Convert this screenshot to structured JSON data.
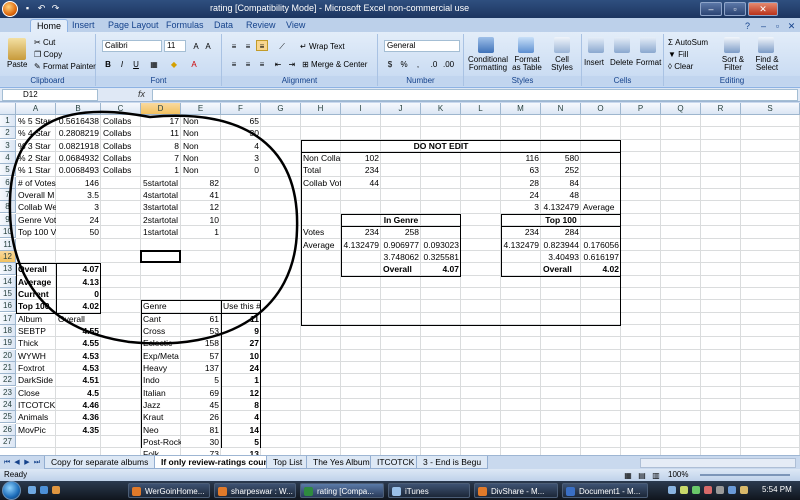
{
  "window": {
    "title": "rating  [Compatibility Mode] - Microsoft Excel non-commercial use",
    "minimize": "–",
    "maximize": "▫",
    "close": "✕"
  },
  "ribbon_tabs": [
    "Home",
    "Insert",
    "Page Layout",
    "Formulas",
    "Data",
    "Review",
    "View"
  ],
  "ribbon": {
    "clipboard": {
      "paste": "Paste",
      "cut": "Cut",
      "copy": "Copy",
      "format_painter": "Format Painter",
      "label": "Clipboard"
    },
    "font": {
      "name": "Calibri",
      "size": "11",
      "label": "Font",
      "bold": "B",
      "italic": "I",
      "underline": "U"
    },
    "alignment": {
      "wrap": "Wrap Text",
      "merge": "Merge & Center",
      "label": "Alignment"
    },
    "number": {
      "format": "General",
      "label": "Number",
      "dollar": "$",
      "percent": "%",
      "comma": ","
    },
    "styles": {
      "conditional": "Conditional Formatting",
      "format_table": "Format as Table",
      "cell_styles": "Cell Styles",
      "label": "Styles"
    },
    "cells": {
      "insert": "Insert",
      "delete": "Delete",
      "format": "Format",
      "label": "Cells"
    },
    "editing": {
      "autosum": "AutoSum",
      "fill": "Fill",
      "clear": "Clear",
      "sort": "Sort & Filter",
      "find": "Find & Select",
      "label": "Editing"
    }
  },
  "formula_bar": {
    "name_box": "D12",
    "fx": "fx",
    "value": ""
  },
  "columns": [
    "A",
    "B",
    "C",
    "D",
    "E",
    "F",
    "G",
    "H",
    "I",
    "J",
    "K",
    "L",
    "M",
    "N",
    "O",
    "P",
    "Q",
    "R",
    "S"
  ],
  "rows": [
    "1",
    "2",
    "3",
    "4",
    "5",
    "6",
    "7",
    "8",
    "9",
    "10",
    "11",
    "12",
    "13",
    "14",
    "15",
    "16",
    "17",
    "18",
    "19",
    "20",
    "21",
    "22",
    "23",
    "24",
    "25",
    "26",
    "27"
  ],
  "cells": {
    "left_block": [
      [
        "% 5 Star",
        "0.5616438",
        "Collabs",
        "17",
        "Non",
        "65"
      ],
      [
        "% 4 Star",
        "0.2808219",
        "Collabs",
        "11",
        "Non",
        "30"
      ],
      [
        "% 3 Star",
        "0.0821918",
        "Collabs",
        "8",
        "Non",
        "4"
      ],
      [
        "% 2 Star",
        "0.0684932",
        "Collabs",
        "7",
        "Non",
        "3"
      ],
      [
        "% 1 Star",
        "0.0068493",
        "Collabs",
        "1",
        "Non",
        "0"
      ],
      [
        "# of Votes",
        "146",
        "",
        "5startotal",
        "82",
        ""
      ],
      [
        "Overall M",
        "3.5",
        "",
        "4startotal",
        "41",
        ""
      ],
      [
        "Collab We",
        "3",
        "",
        "3startotal",
        "12",
        ""
      ],
      [
        "Genre Vot",
        "24",
        "",
        "2startotal",
        "10",
        ""
      ],
      [
        "Top 100 V",
        "50",
        "",
        "1startotal",
        "1",
        ""
      ]
    ],
    "summary": [
      [
        "Overall",
        "4.07"
      ],
      [
        "Average",
        "4.13"
      ],
      [
        "Current",
        "0"
      ],
      [
        "Top 100",
        "4.02"
      ]
    ],
    "album_header": [
      "Album",
      "Overall"
    ],
    "albums": [
      [
        "SEBTP",
        "4.55"
      ],
      [
        "Thick",
        "4.55"
      ],
      [
        "WYWH",
        "4.53"
      ],
      [
        "Foxtrot",
        "4.53"
      ],
      [
        "DarkSide",
        "4.51"
      ],
      [
        "Close",
        "4.5"
      ],
      [
        "ITCOTCK",
        "4.46"
      ],
      [
        "Animals",
        "4.36"
      ],
      [
        "MovPic",
        "4.35"
      ]
    ],
    "genre_header": [
      "Genre",
      "",
      "Use this #"
    ],
    "genres": [
      [
        "Cant",
        "61",
        "11"
      ],
      [
        "Cross",
        "53",
        "9"
      ],
      [
        "Eclectic",
        "158",
        "27"
      ],
      [
        "Exp/Meta",
        "57",
        "10"
      ],
      [
        "Heavy",
        "137",
        "24"
      ],
      [
        "Indo",
        "5",
        "1"
      ],
      [
        "Italian",
        "69",
        "12"
      ],
      [
        "Jazz",
        "45",
        "8"
      ],
      [
        "Kraut",
        "26",
        "4"
      ],
      [
        "Neo",
        "81",
        "14"
      ],
      [
        "Post-Rock",
        "30",
        "5"
      ],
      [
        "Folk",
        "73",
        "13"
      ]
    ],
    "do_not_edit": {
      "title": "DO NOT EDIT",
      "rows": [
        [
          "Non Colla",
          "102"
        ],
        [
          "Total",
          "234"
        ],
        [
          "Collab Vot",
          "44"
        ]
      ],
      "right": [
        [
          "116",
          "580",
          ""
        ],
        [
          "63",
          "252",
          ""
        ],
        [
          "28",
          "84",
          ""
        ],
        [
          "24",
          "48",
          ""
        ],
        [
          "3",
          "4.132479",
          "Average"
        ]
      ],
      "in_genre": {
        "title": "In Genre",
        "votes_label": "Votes",
        "avg_label": "Average",
        "votes": [
          "234",
          "258",
          ""
        ],
        "avg": [
          "4.132479",
          "0.906977",
          "0.093023"
        ],
        "row3": [
          "",
          "3.748062",
          "0.325581"
        ],
        "overall_label": "Overall",
        "overall": "4.07"
      },
      "top100": {
        "title": "Top 100",
        "votes": [
          "234",
          "284",
          ""
        ],
        "avg": [
          "4.132479",
          "0.823944",
          "0.176056"
        ],
        "row3": [
          "",
          "3.40493",
          "0.616197"
        ],
        "overall_label": "Overall",
        "overall": "4.02"
      }
    }
  },
  "sheet_tabs": [
    "Copy for separate albums",
    "If only review-ratings count",
    "Top List",
    "The Yes Album",
    "ITCOTCK",
    "3 - End is Begu"
  ],
  "active_sheet": "If only review-ratings count",
  "status": {
    "ready": "Ready",
    "zoom": "100%"
  },
  "taskbar": {
    "items": [
      "WerGoinHome...",
      "sharpeswar : W...",
      "rating  [Compa...",
      "iTunes",
      "DivShare - M...",
      "Document1 - M..."
    ],
    "clock": "5:54 PM"
  },
  "colors": {
    "ribbon": "#e3edf9",
    "taskbar": "#1c2738",
    "selected_header": "#f1c15f"
  }
}
